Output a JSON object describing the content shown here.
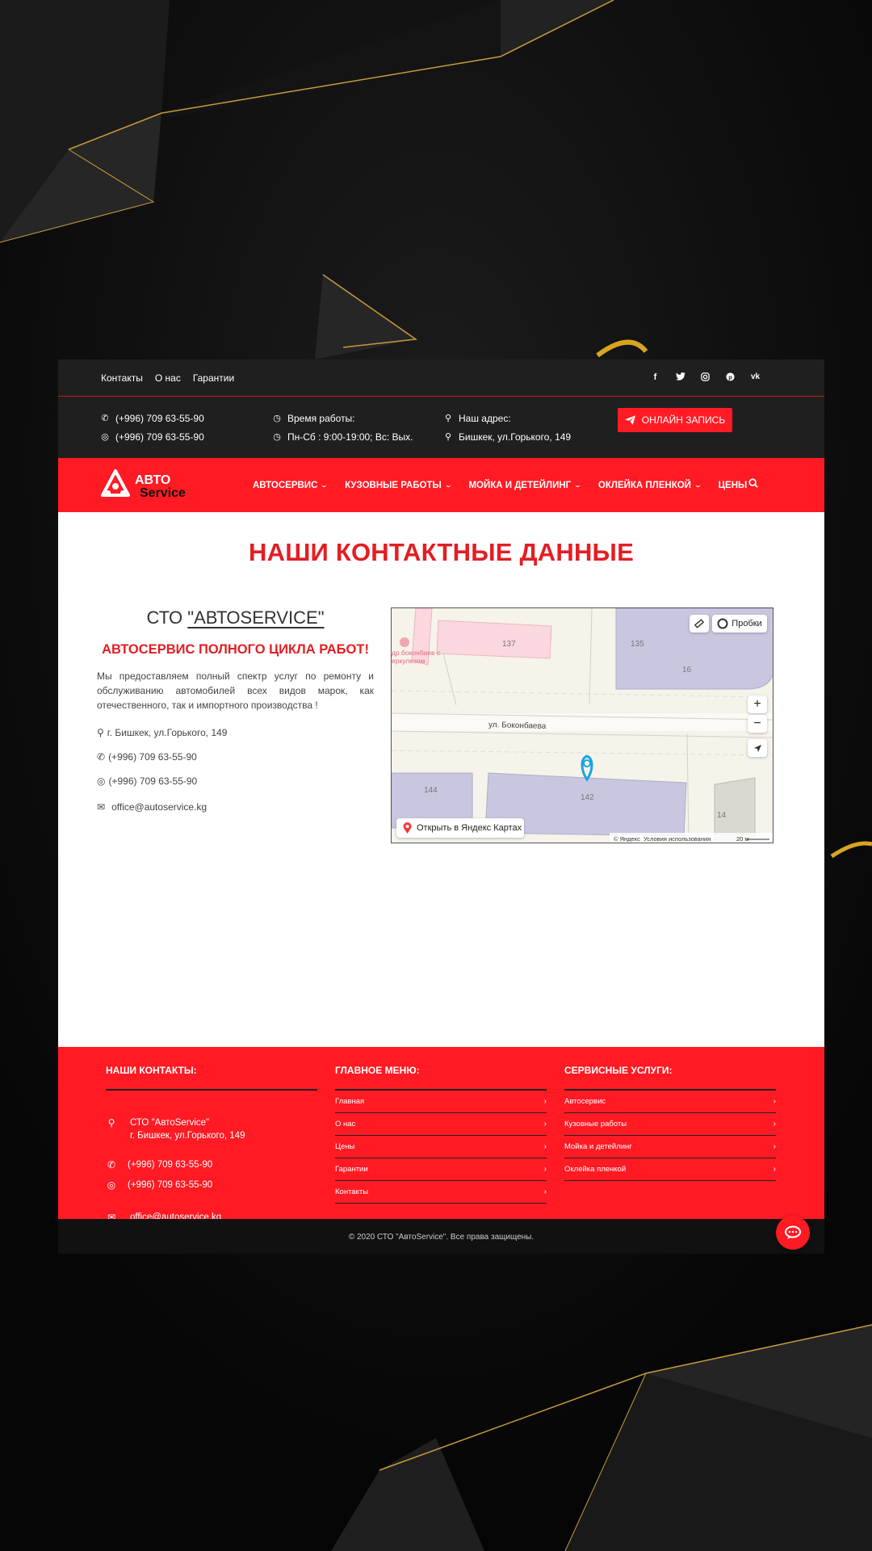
{
  "topbar": {
    "links": [
      "Контакты",
      "О нас",
      "Гарантии"
    ],
    "social_icons": [
      "facebook-icon",
      "twitter-icon",
      "instagram-icon",
      "pinterest-icon",
      "vk-icon"
    ]
  },
  "info": {
    "phone1": "(+996) 709 63-55-90",
    "phone2": "(+996) 709 63-55-90",
    "hours_label": "Время работы:",
    "hours_value": "Пн-Сб : 9:00-19:00; Вс: Вых.",
    "address_label": "Наш адрес:",
    "address_value": "Бишкек, ул.Горького, 149",
    "cta_label": "ОНЛАЙН ЗАПИСЬ"
  },
  "logo": {
    "line1": "АВТО",
    "line2": "Service"
  },
  "nav": {
    "items": [
      {
        "label": "АВТОСЕРВИС",
        "dropdown": true
      },
      {
        "label": "КУЗОВНЫЕ РАБОТЫ",
        "dropdown": true
      },
      {
        "label": "МОЙКА И ДЕТЕЙЛИНГ",
        "dropdown": true
      },
      {
        "label": "ОКЛЕЙКА ПЛЕНКОЙ",
        "dropdown": true
      },
      {
        "label": "ЦЕНЫ",
        "dropdown": false
      }
    ]
  },
  "content": {
    "title": "НАШИ КОНТАКТНЫЕ ДАННЫЕ",
    "cto_prefix": "СТО ",
    "cto_name": "\"АВТОSERVICE\"",
    "subtitle": "АВТОСЕРВИС ПОЛНОГО ЦИКЛА РАБОТ!",
    "description": "Мы предоставляем полный спектр услуг по ремонту и обслуживанию автомобилей всех видов марок, как отечественного, так и импортного производства !",
    "address": "г. Бишкек, ул.Горького, 149",
    "phone": "(+996) 709 63-55-90",
    "whatsapp": "(+996) 709 63-55-90",
    "email": "office@autoservice.kg"
  },
  "map": {
    "traffic_label": "Пробки",
    "street": "ул. Боконбаева",
    "buildings": [
      "137",
      "135",
      "16",
      "144",
      "142",
      "14"
    ],
    "poi_label_1": "др.боконбаев с",
    "poi_label_2": "еркулезом",
    "open_label": "Открыть в Яндекс Картах",
    "copyright": "© Яндекс",
    "terms": "Условия использования",
    "scale": "20 м",
    "zoom_in": "+",
    "zoom_out": "−"
  },
  "footer": {
    "contacts_title": "НАШИ КОНТАКТЫ:",
    "contact_name": "СТО \"АвтоService\"",
    "contact_address": "г. Бишкек, ул.Горького, 149",
    "contact_phone": "(+996) 709 63-55-90",
    "contact_whatsapp": "(+996) 709 63-55-90",
    "contact_email": "office@autoservice.kg",
    "menu_title": "ГЛАВНОЕ МЕНЮ:",
    "menu_items": [
      "Главная",
      "О нас",
      "Цены",
      "Гарантии",
      "Контакты"
    ],
    "services_title": "СЕРВИСНЫЕ УСЛУГИ:",
    "service_items": [
      "Автосервис",
      "Кузовные работы",
      "Мойка и детейлинг",
      "Оклейка пленкой"
    ],
    "copyright": "© 2020 СТО \"АвтоService\". Все права защищены."
  },
  "colors": {
    "brand_red": "#ff1a24",
    "title_red": "#e31e24",
    "dark": "#1f1f1f"
  }
}
